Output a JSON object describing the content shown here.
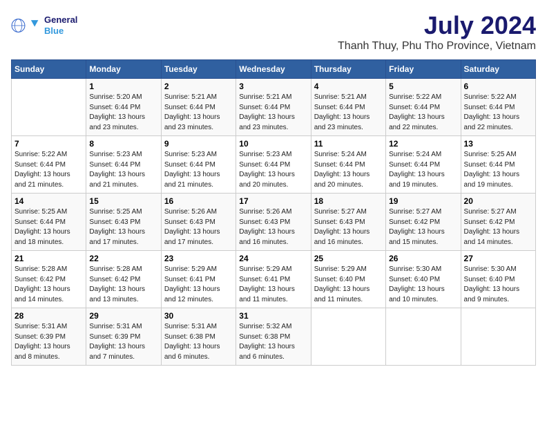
{
  "header": {
    "logo_line1": "General",
    "logo_line2": "Blue",
    "title": "July 2024",
    "subtitle": "Thanh Thuy, Phu Tho Province, Vietnam"
  },
  "days_of_week": [
    "Sunday",
    "Monday",
    "Tuesday",
    "Wednesday",
    "Thursday",
    "Friday",
    "Saturday"
  ],
  "weeks": [
    [
      {
        "day": "",
        "detail": ""
      },
      {
        "day": "1",
        "detail": "Sunrise: 5:20 AM\nSunset: 6:44 PM\nDaylight: 13 hours\nand 23 minutes."
      },
      {
        "day": "2",
        "detail": "Sunrise: 5:21 AM\nSunset: 6:44 PM\nDaylight: 13 hours\nand 23 minutes."
      },
      {
        "day": "3",
        "detail": "Sunrise: 5:21 AM\nSunset: 6:44 PM\nDaylight: 13 hours\nand 23 minutes."
      },
      {
        "day": "4",
        "detail": "Sunrise: 5:21 AM\nSunset: 6:44 PM\nDaylight: 13 hours\nand 23 minutes."
      },
      {
        "day": "5",
        "detail": "Sunrise: 5:22 AM\nSunset: 6:44 PM\nDaylight: 13 hours\nand 22 minutes."
      },
      {
        "day": "6",
        "detail": "Sunrise: 5:22 AM\nSunset: 6:44 PM\nDaylight: 13 hours\nand 22 minutes."
      }
    ],
    [
      {
        "day": "7",
        "detail": "Sunrise: 5:22 AM\nSunset: 6:44 PM\nDaylight: 13 hours\nand 21 minutes."
      },
      {
        "day": "8",
        "detail": "Sunrise: 5:23 AM\nSunset: 6:44 PM\nDaylight: 13 hours\nand 21 minutes."
      },
      {
        "day": "9",
        "detail": "Sunrise: 5:23 AM\nSunset: 6:44 PM\nDaylight: 13 hours\nand 21 minutes."
      },
      {
        "day": "10",
        "detail": "Sunrise: 5:23 AM\nSunset: 6:44 PM\nDaylight: 13 hours\nand 20 minutes."
      },
      {
        "day": "11",
        "detail": "Sunrise: 5:24 AM\nSunset: 6:44 PM\nDaylight: 13 hours\nand 20 minutes."
      },
      {
        "day": "12",
        "detail": "Sunrise: 5:24 AM\nSunset: 6:44 PM\nDaylight: 13 hours\nand 19 minutes."
      },
      {
        "day": "13",
        "detail": "Sunrise: 5:25 AM\nSunset: 6:44 PM\nDaylight: 13 hours\nand 19 minutes."
      }
    ],
    [
      {
        "day": "14",
        "detail": "Sunrise: 5:25 AM\nSunset: 6:44 PM\nDaylight: 13 hours\nand 18 minutes."
      },
      {
        "day": "15",
        "detail": "Sunrise: 5:25 AM\nSunset: 6:43 PM\nDaylight: 13 hours\nand 17 minutes."
      },
      {
        "day": "16",
        "detail": "Sunrise: 5:26 AM\nSunset: 6:43 PM\nDaylight: 13 hours\nand 17 minutes."
      },
      {
        "day": "17",
        "detail": "Sunrise: 5:26 AM\nSunset: 6:43 PM\nDaylight: 13 hours\nand 16 minutes."
      },
      {
        "day": "18",
        "detail": "Sunrise: 5:27 AM\nSunset: 6:43 PM\nDaylight: 13 hours\nand 16 minutes."
      },
      {
        "day": "19",
        "detail": "Sunrise: 5:27 AM\nSunset: 6:42 PM\nDaylight: 13 hours\nand 15 minutes."
      },
      {
        "day": "20",
        "detail": "Sunrise: 5:27 AM\nSunset: 6:42 PM\nDaylight: 13 hours\nand 14 minutes."
      }
    ],
    [
      {
        "day": "21",
        "detail": "Sunrise: 5:28 AM\nSunset: 6:42 PM\nDaylight: 13 hours\nand 14 minutes."
      },
      {
        "day": "22",
        "detail": "Sunrise: 5:28 AM\nSunset: 6:42 PM\nDaylight: 13 hours\nand 13 minutes."
      },
      {
        "day": "23",
        "detail": "Sunrise: 5:29 AM\nSunset: 6:41 PM\nDaylight: 13 hours\nand 12 minutes."
      },
      {
        "day": "24",
        "detail": "Sunrise: 5:29 AM\nSunset: 6:41 PM\nDaylight: 13 hours\nand 11 minutes."
      },
      {
        "day": "25",
        "detail": "Sunrise: 5:29 AM\nSunset: 6:40 PM\nDaylight: 13 hours\nand 11 minutes."
      },
      {
        "day": "26",
        "detail": "Sunrise: 5:30 AM\nSunset: 6:40 PM\nDaylight: 13 hours\nand 10 minutes."
      },
      {
        "day": "27",
        "detail": "Sunrise: 5:30 AM\nSunset: 6:40 PM\nDaylight: 13 hours\nand 9 minutes."
      }
    ],
    [
      {
        "day": "28",
        "detail": "Sunrise: 5:31 AM\nSunset: 6:39 PM\nDaylight: 13 hours\nand 8 minutes."
      },
      {
        "day": "29",
        "detail": "Sunrise: 5:31 AM\nSunset: 6:39 PM\nDaylight: 13 hours\nand 7 minutes."
      },
      {
        "day": "30",
        "detail": "Sunrise: 5:31 AM\nSunset: 6:38 PM\nDaylight: 13 hours\nand 6 minutes."
      },
      {
        "day": "31",
        "detail": "Sunrise: 5:32 AM\nSunset: 6:38 PM\nDaylight: 13 hours\nand 6 minutes."
      },
      {
        "day": "",
        "detail": ""
      },
      {
        "day": "",
        "detail": ""
      },
      {
        "day": "",
        "detail": ""
      }
    ]
  ]
}
